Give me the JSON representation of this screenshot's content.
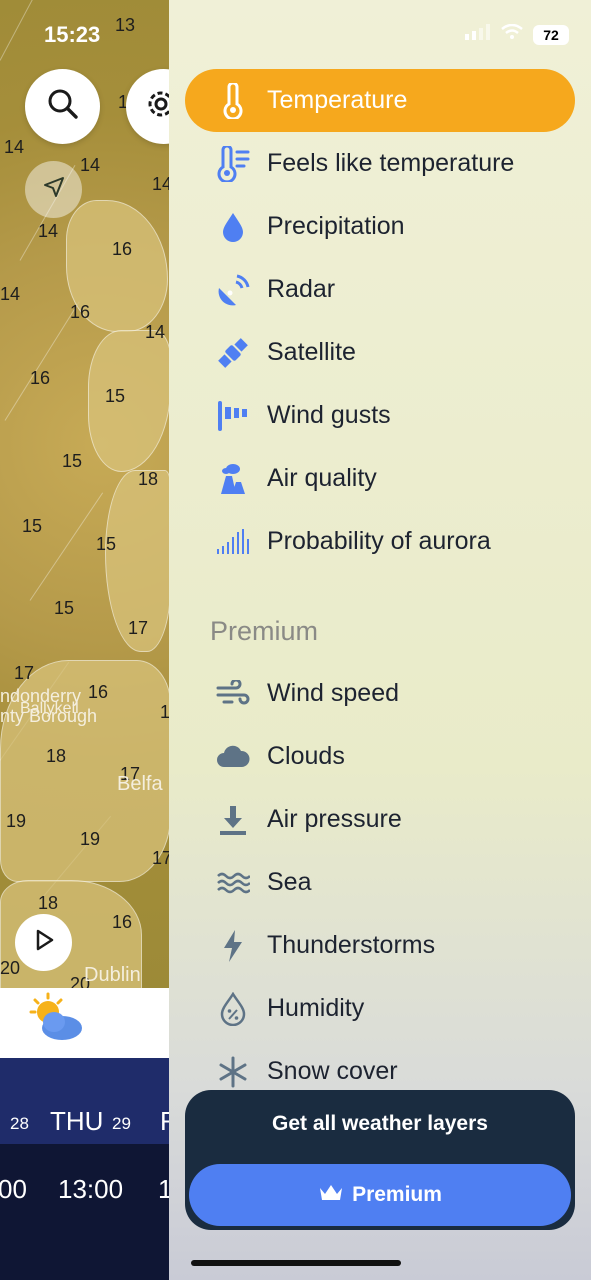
{
  "status_bar": {
    "time": "15:23",
    "battery": "72"
  },
  "map": {
    "temperatures": [
      "13",
      "1",
      "14",
      "14",
      "14",
      "14",
      "16",
      "14",
      "16",
      "14",
      "16",
      "15",
      "15",
      "18",
      "15",
      "15",
      "15",
      "17",
      "17",
      "16",
      "1",
      "18",
      "17",
      "19",
      "19",
      "17",
      "18",
      "16",
      "20",
      "20"
    ],
    "places": [
      "ndonderry",
      "Ballykell",
      "nty Borough",
      "Belfa",
      "Dublin"
    ]
  },
  "forecast_strip": {
    "days": [
      {
        "day": "",
        "num": "28"
      },
      {
        "day": "THU",
        "num": "29"
      },
      {
        "day": "F",
        "num": ""
      }
    ],
    "times": [
      "00",
      "13:00",
      "1"
    ]
  },
  "drawer": {
    "items": [
      {
        "label": "Temperature",
        "icon": "thermometer-icon"
      },
      {
        "label": "Feels like temperature",
        "icon": "feels-like-icon"
      },
      {
        "label": "Precipitation",
        "icon": "raindrop-icon"
      },
      {
        "label": "Radar",
        "icon": "radar-icon"
      },
      {
        "label": "Satellite",
        "icon": "satellite-icon"
      },
      {
        "label": "Wind gusts",
        "icon": "wind-gusts-icon"
      },
      {
        "label": "Air quality",
        "icon": "factory-icon"
      },
      {
        "label": "Probability of aurora",
        "icon": "aurora-icon"
      }
    ],
    "premium_title": "Premium",
    "premium_items": [
      {
        "label": "Wind speed",
        "icon": "wind-icon"
      },
      {
        "label": "Clouds",
        "icon": "cloud-icon"
      },
      {
        "label": "Air pressure",
        "icon": "pressure-icon"
      },
      {
        "label": "Sea",
        "icon": "waves-icon"
      },
      {
        "label": "Thunderstorms",
        "icon": "lightning-icon"
      },
      {
        "label": "Humidity",
        "icon": "humidity-icon"
      },
      {
        "label": "Snow cover",
        "icon": "snowflake-icon"
      }
    ],
    "promo": {
      "title": "Get all weather layers",
      "button": "Premium"
    }
  },
  "colors": {
    "accent": "#f6a81d",
    "icon_blue": "#4f7ff2",
    "premium_icon": "#5e7386",
    "promo_bg": "#1a2c40",
    "promo_button": "#4f7ff2"
  }
}
